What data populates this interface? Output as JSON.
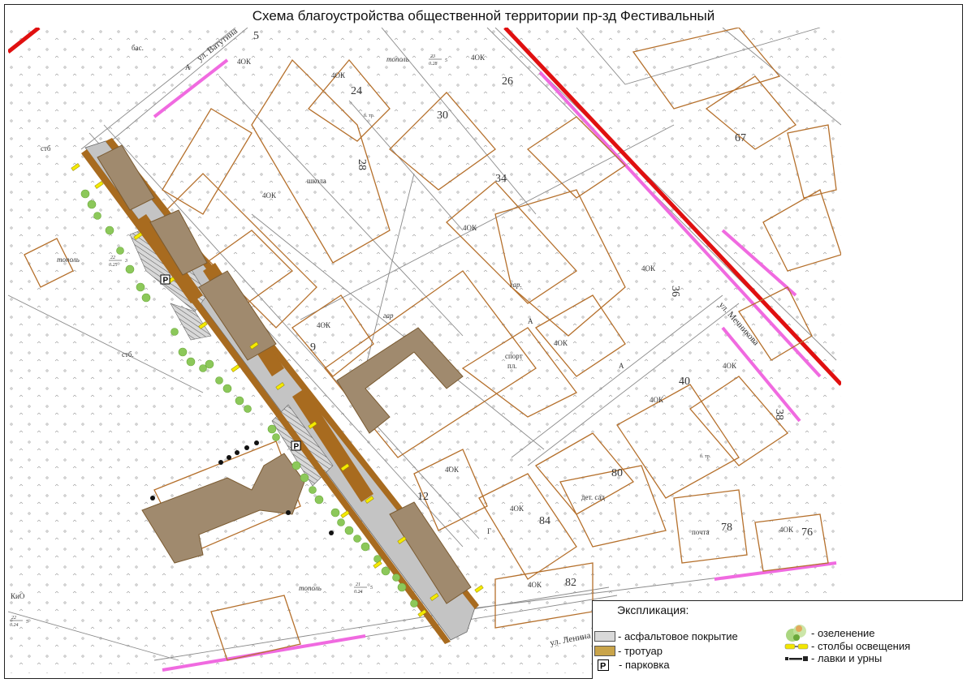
{
  "title": "Схема благоустройства общественной территории пр-зд Фестивальный",
  "map": {
    "streets": {
      "vatutina": "ул. Ватутина",
      "mechnikova": "ул. Мечникова",
      "lenina": "ул. Ленина"
    },
    "house_numbers": [
      "24",
      "26",
      "28",
      "30",
      "34",
      "36",
      "38",
      "40",
      "67",
      "76",
      "78",
      "80",
      "82",
      "84",
      "9",
      "12",
      "5"
    ],
    "building_labels": {
      "floors_4": "4ОК",
      "school": "школа",
      "post": "почта",
      "kindergarten": "дет. сад",
      "sport": "спорт",
      "sport_pl": "пл.",
      "gar": "гар",
      "gar2": "гар.",
      "tp": "б. тр.",
      "stb": "стб.",
      "stb2": "стб",
      "bas": "бас.",
      "kio": "КиО",
      "letter_a": "А",
      "letter_g": "Г",
      "zh": "Ж",
      "vod": "вод."
    },
    "tree_labels": [
      {
        "name": "тополь",
        "num": "22",
        "den": "0.25",
        "h": "3"
      },
      {
        "name": "тополь",
        "num": "21",
        "den": "0.24",
        "h": "5"
      },
      {
        "name": "тополь",
        "num": "23",
        "den": "0.28",
        "h": "5"
      },
      {
        "name": "",
        "num": "22",
        "den": "0.24",
        "h": "5"
      }
    ]
  },
  "legend": {
    "title": "Экспликация:",
    "items": [
      {
        "key": "asphalt",
        "label": "- асфальтовое покрытие",
        "color": "#d9d9d9"
      },
      {
        "key": "sidewalk",
        "label": "- тротуар",
        "color": "#c9a44a"
      },
      {
        "key": "parking",
        "label": "- парковка",
        "symbol": "P"
      },
      {
        "key": "greenery",
        "label": "- озеленение",
        "color": "#9bcf6a"
      },
      {
        "key": "lighting",
        "label": "- столбы освещения",
        "color": "#f2e600"
      },
      {
        "key": "benches",
        "label": "- лавки и урны",
        "color": "#222222"
      }
    ]
  },
  "colors": {
    "building_outline": "#b5702c",
    "building_fill": "#a08a6e",
    "red_line": "#e01010",
    "pink_line": "#f06ae0",
    "asphalt": "#c4c4c4",
    "sidewalk": "#a86b1f",
    "tree": "#8cc85a",
    "lamp": "#f4ea00"
  }
}
